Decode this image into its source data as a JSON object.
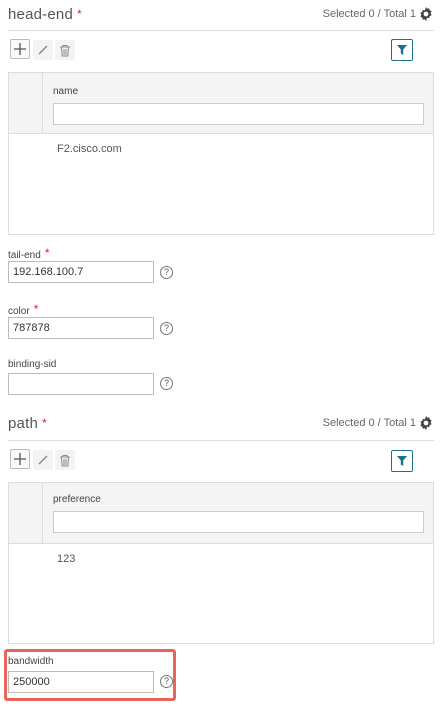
{
  "head_end": {
    "title": "head-end",
    "required_mark": "*",
    "selection_summary": "Selected 0 / Total 1",
    "column_header": "name",
    "rows": [
      "F2.cisco.com"
    ]
  },
  "fields": {
    "tail_end": {
      "label": "tail-end",
      "required_mark": "*",
      "value": "192.168.100.7",
      "help": "?"
    },
    "color": {
      "label": "color",
      "required_mark": "*",
      "value": "787878",
      "help": "?"
    },
    "binding_sid": {
      "label": "binding-sid",
      "value": "",
      "help": "?"
    }
  },
  "path": {
    "title": "path",
    "required_mark": "*",
    "selection_summary": "Selected 0 / Total 1",
    "column_header": "preference",
    "rows": [
      "123"
    ]
  },
  "bandwidth": {
    "label": "bandwidth",
    "value": "250000",
    "help": "?"
  },
  "colors": {
    "required": "#d9262e",
    "accent": "#1b6e96",
    "highlight": "#e8645a"
  }
}
